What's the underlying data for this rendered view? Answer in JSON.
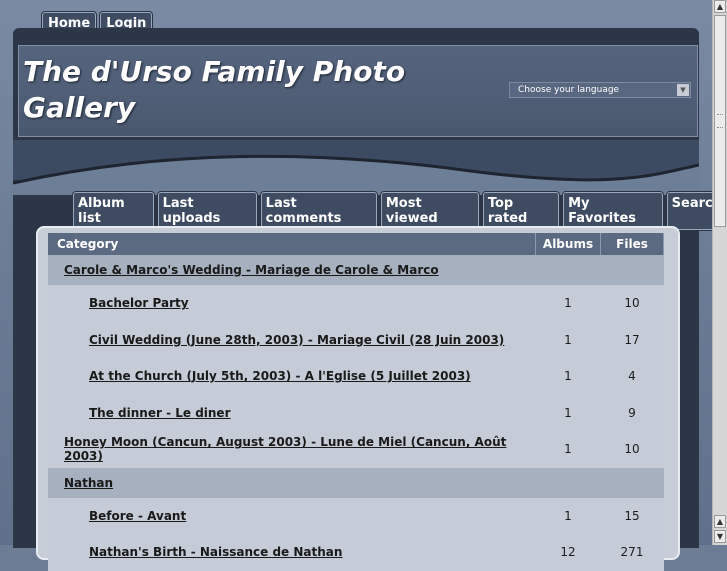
{
  "top_nav": {
    "home": "Home",
    "login": "Login"
  },
  "site": {
    "title": "The d'Urso Family Photo Gallery"
  },
  "language": {
    "selected": "Choose your language"
  },
  "menu": [
    "Album list",
    "Last uploads",
    "Last comments",
    "Most viewed",
    "Top rated",
    "My Favorites",
    "Search"
  ],
  "table": {
    "headers": {
      "category": "Category",
      "albums": "Albums",
      "files": "Files"
    },
    "rows": [
      {
        "kind": "main",
        "name": "Carole & Marco's Wedding - Mariage de Carole & Marco",
        "albums": "",
        "files": ""
      },
      {
        "kind": "sub",
        "name": "Bachelor Party",
        "albums": "1",
        "files": "10"
      },
      {
        "kind": "sub",
        "name": "Civil Wedding (June 28th, 2003) - Mariage Civil (28 Juin 2003)",
        "albums": "1",
        "files": "17"
      },
      {
        "kind": "sub",
        "name": "At the Church (July 5th, 2003) - A l'Eglise (5 Juillet 2003)",
        "albums": "1",
        "files": "4"
      },
      {
        "kind": "sub",
        "name": "The dinner - Le diner",
        "albums": "1",
        "files": "9"
      },
      {
        "kind": "sub1",
        "name": "Honey Moon (Cancun, August 2003) - Lune de Miel (Cancun, Août 2003)",
        "albums": "1",
        "files": "10"
      },
      {
        "kind": "main",
        "name": "Nathan",
        "albums": "",
        "files": ""
      },
      {
        "kind": "sub",
        "name": "Before - Avant",
        "albums": "1",
        "files": "15"
      },
      {
        "kind": "sub",
        "name": "Nathan's Birth - Naissance de Nathan",
        "albums": "12",
        "files": "271"
      }
    ]
  },
  "icons": {
    "scroll_up": "triangle-up",
    "scroll_down": "triangle-down",
    "dropdown": "triangle-down"
  },
  "colors": {
    "header": "#4a586f",
    "frame": "#2d3646",
    "button": "#3e4b60",
    "panel": "#c7cdd7"
  }
}
